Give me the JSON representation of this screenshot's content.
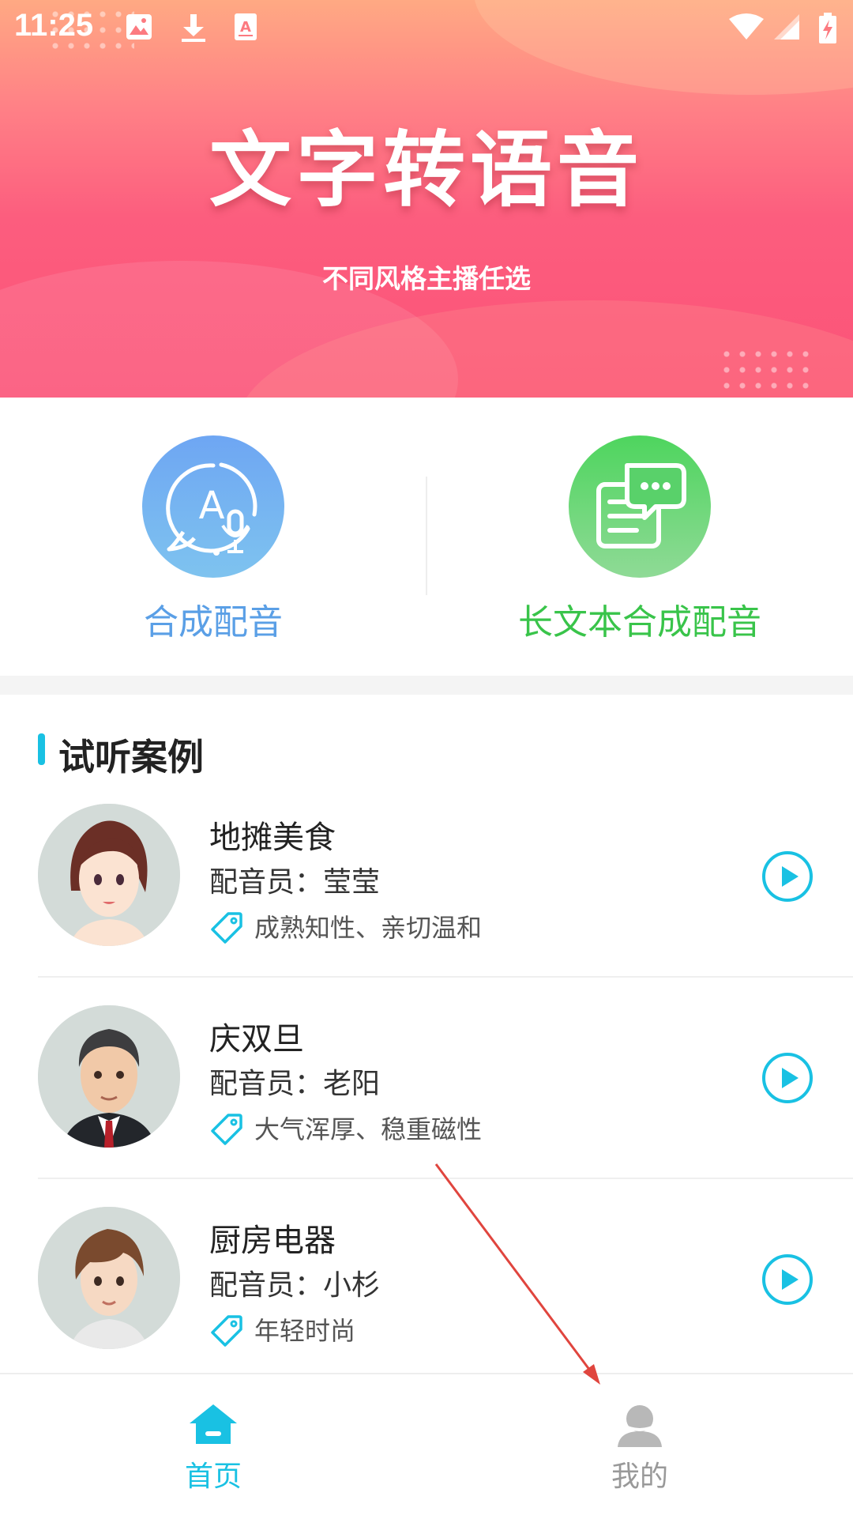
{
  "status_bar": {
    "time": "11:25",
    "left_icons": [
      "image-icon",
      "download-icon",
      "font-icon"
    ],
    "right_icons": [
      "wifi-icon",
      "signal-icon",
      "battery-charging-icon"
    ]
  },
  "banner": {
    "title": "文字转语音",
    "subtitle": "不同风格主播任选"
  },
  "features": [
    {
      "label": "合成配音",
      "icon": "speech-mic-icon",
      "color": "#5a9fe6"
    },
    {
      "label": "长文本合成配音",
      "icon": "chat-document-icon",
      "color": "#39c44a"
    }
  ],
  "samples_section": {
    "title": "试听案例",
    "accent": "#19c1e3"
  },
  "samples": [
    {
      "title": "地摊美食",
      "voice": "配音员：莹莹",
      "tags": "成熟知性、亲切温和"
    },
    {
      "title": "庆双旦",
      "voice": "配音员：老阳",
      "tags": "大气浑厚、稳重磁性"
    },
    {
      "title": "厨房电器",
      "voice": "配音员：小杉",
      "tags": "年轻时尚"
    }
  ],
  "bottom_nav": [
    {
      "label": "首页",
      "icon": "home-icon",
      "active": true
    },
    {
      "label": "我的",
      "icon": "user-icon",
      "active": false
    }
  ]
}
